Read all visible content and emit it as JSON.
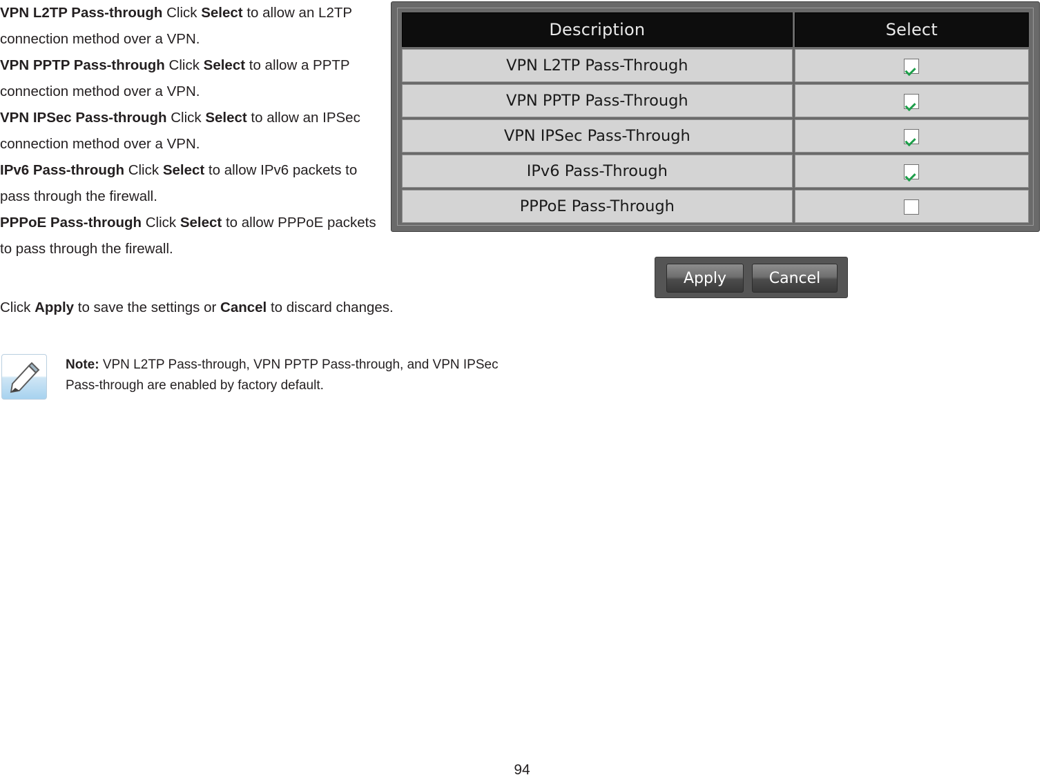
{
  "body": {
    "paragraphs": [
      {
        "term": "VPN L2TP Pass-through",
        "mid": " Click ",
        "action": "Select",
        "rest": " to allow an L2TP connection method over a VPN."
      },
      {
        "term": "VPN PPTP Pass-through",
        "mid": " Click ",
        "action": "Select",
        "rest": " to allow a PPTP connection method over a VPN."
      },
      {
        "term": "VPN IPSec Pass-through",
        "mid": " Click ",
        "action": "Select",
        "rest": " to allow an IPSec connection method over a VPN."
      },
      {
        "term": "IPv6 Pass-through",
        "mid": " Click ",
        "action": "Select",
        "rest": " to allow IPv6 packets to pass through the firewall."
      },
      {
        "term": "PPPoE Pass-through",
        "mid": " Click ",
        "action": "Select",
        "rest": " to allow PPPoE packets to pass through the firewall."
      }
    ],
    "apply_line": {
      "pre": "Click ",
      "apply": "Apply",
      "mid": " to save the settings or ",
      "cancel": "Cancel",
      "post": " to discard changes."
    },
    "note": {
      "label": "Note:",
      "text": " VPN L2TP Pass-through, VPN PPTP Pass-through, and VPN IPSec Pass-through are enabled by factory default."
    }
  },
  "screenshot": {
    "table": {
      "headers": [
        "Description",
        "Select"
      ],
      "rows": [
        {
          "description": "VPN L2TP Pass-Through",
          "checked": true
        },
        {
          "description": "VPN PPTP Pass-Through",
          "checked": true
        },
        {
          "description": "VPN IPSec Pass-Through",
          "checked": true
        },
        {
          "description": "IPv6 Pass-Through",
          "checked": true
        },
        {
          "description": "PPPoE Pass-Through",
          "checked": false
        }
      ]
    },
    "buttons": {
      "apply": "Apply",
      "cancel": "Cancel"
    }
  },
  "footer": {
    "page_number": "94"
  },
  "colors": {
    "text": "#231f20",
    "header_bg": "#0d0d0d",
    "row_bg": "#d4d4d4",
    "panel_bg": "#6a6a6a",
    "check_green": "#1e9e4a",
    "note_border": "#b9cfe0"
  }
}
